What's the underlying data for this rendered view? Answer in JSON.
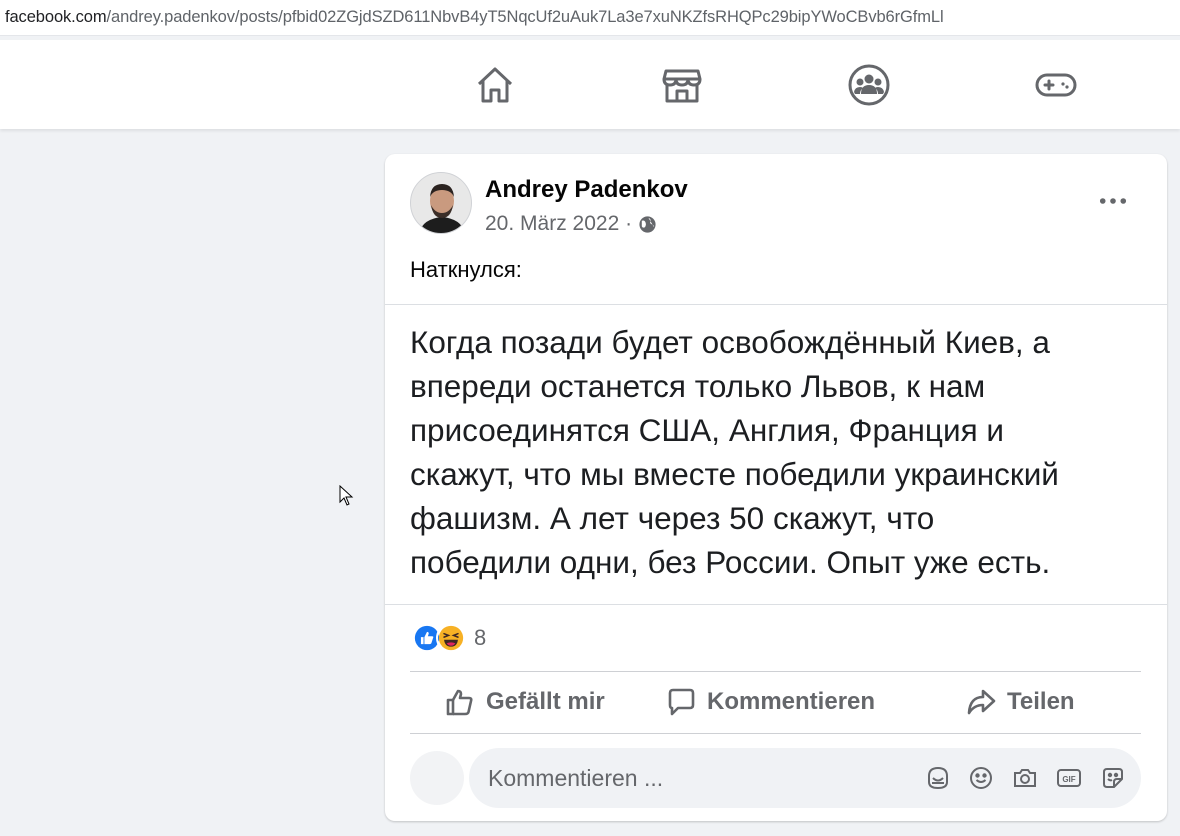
{
  "browser": {
    "url_domain": "facebook.com",
    "url_path": "/andrey.padenkov/posts/pfbid02ZGjdSZD611NbvB4yT5NqcUf2uAuk7La3e7xuNKZfsRHQPc29bipYWoCBvb6rGfmLl"
  },
  "nav": {
    "icons": [
      "home-icon",
      "marketplace-icon",
      "groups-icon",
      "gaming-icon"
    ]
  },
  "post": {
    "author": "Andrey Padenkov",
    "date": "20. März 2022 ·",
    "privacy_icon": "globe-icon",
    "caption": "Наткнулся:",
    "lines": [
      "Когда позади будет освобождённый Киев, а",
      "впереди останется только Львов, к нам",
      "присоединятся США, Англия, Франция и",
      "скажут, что мы вместе победили украинский",
      "фашизм. А лет через 50 скажут, что",
      "победили одни, без России. Опыт уже есть."
    ],
    "reactions": {
      "types": [
        "like",
        "haha"
      ],
      "count": "8"
    },
    "actions": {
      "like": "Gefällt mir",
      "comment": "Kommentieren",
      "share": "Teilen"
    },
    "comment_placeholder": "Kommentieren ..."
  },
  "colors": {
    "background": "#f0f2f5",
    "card": "#ffffff",
    "icon_gray": "#65676b",
    "like_blue": "#1877f2",
    "haha_yellow": "#f7b125"
  }
}
